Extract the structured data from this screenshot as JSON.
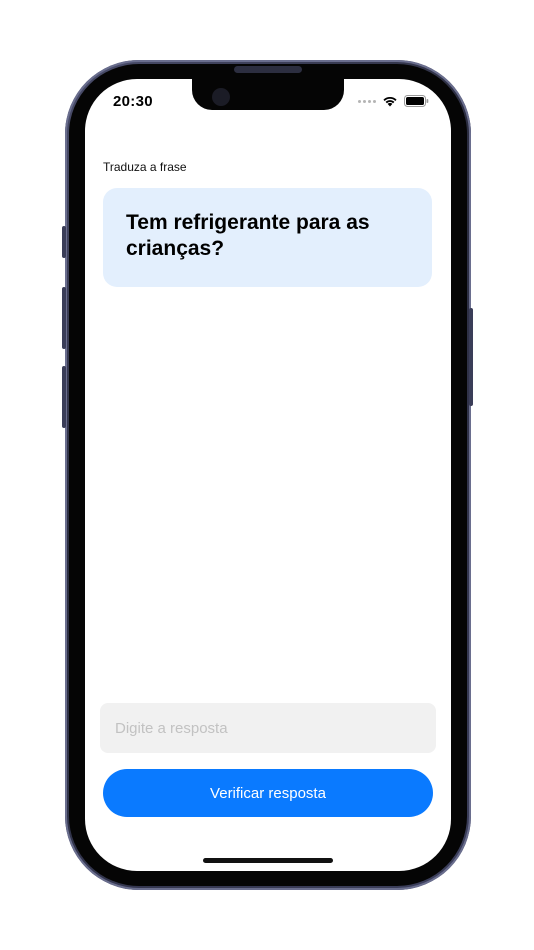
{
  "status_bar": {
    "time": "20:30",
    "icons": [
      "signal-dots-icon",
      "wifi-icon",
      "battery-icon"
    ]
  },
  "exercise": {
    "instruction": "Traduza a frase",
    "phrase": "Tem refrigerante para as crianças?"
  },
  "answer": {
    "placeholder": "Digite a resposta",
    "value": ""
  },
  "actions": {
    "check_label": "Verificar resposta"
  },
  "colors": {
    "accent": "#0A7AFF",
    "card_background": "#E3EFFD",
    "input_background": "#F1F1F1"
  }
}
